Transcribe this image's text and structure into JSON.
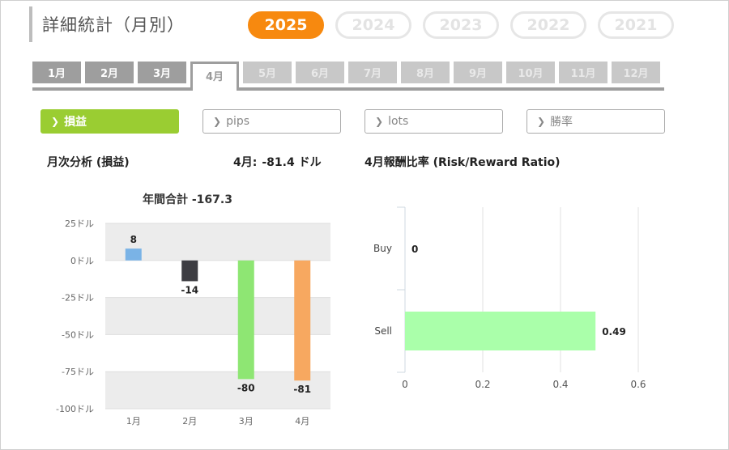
{
  "page": {
    "title": "詳細統計（月別）"
  },
  "years": [
    {
      "label": "2025",
      "active": true
    },
    {
      "label": "2024",
      "active": false
    },
    {
      "label": "2023",
      "active": false
    },
    {
      "label": "2022",
      "active": false
    },
    {
      "label": "2021",
      "active": false
    }
  ],
  "months": [
    "1月",
    "2月",
    "3月",
    "4月",
    "5月",
    "6月",
    "7月",
    "8月",
    "9月",
    "10月",
    "11月",
    "12月"
  ],
  "active_month_index": 3,
  "enabled_months": 4,
  "metrics": [
    {
      "label": "損益",
      "active": true
    },
    {
      "label": "pips",
      "active": false
    },
    {
      "label": "lots",
      "active": false
    },
    {
      "label": "勝率",
      "active": false
    }
  ],
  "labels": {
    "monthly_analysis": "月次分析 (損益)",
    "month_prefix": "4月:",
    "month_value": "-81.4 ドル",
    "rr_title": "4月報酬比率 (Risk/Reward Ratio)",
    "annual_total": "年間合計 -167.3"
  },
  "chart_data": [
    {
      "type": "bar",
      "title": "年間合計 -167.3",
      "categories": [
        "1月",
        "2月",
        "3月",
        "4月"
      ],
      "values": [
        8,
        -14,
        -80,
        -81
      ],
      "data_labels": [
        "8",
        "-14",
        "-80",
        "-81"
      ],
      "bar_colors": [
        "#7ab3e6",
        "#3d3d42",
        "#8ee673",
        "#f7a860"
      ],
      "yticks": [
        25,
        0,
        -25,
        -50,
        -75,
        -100
      ],
      "ytick_labels": [
        "25ドル",
        "0ドル",
        "-25ドル",
        "-50ドル",
        "-75ドル",
        "-100ドル"
      ],
      "ylim": [
        -100,
        25
      ],
      "grid": "alternating bands"
    },
    {
      "type": "bar",
      "orientation": "horizontal",
      "title": "4月報酬比率 (Risk/Reward Ratio)",
      "categories": [
        "Buy",
        "Sell"
      ],
      "values": [
        0,
        0.49
      ],
      "data_labels": [
        "0",
        "0.49"
      ],
      "bar_color": "#aaffaa",
      "xticks": [
        0,
        0.2,
        0.4,
        0.6
      ],
      "xtick_labels": [
        "0",
        "0.2",
        "0.4",
        "0.6"
      ],
      "xlim": [
        0,
        0.6
      ],
      "grid": "vertical"
    }
  ]
}
